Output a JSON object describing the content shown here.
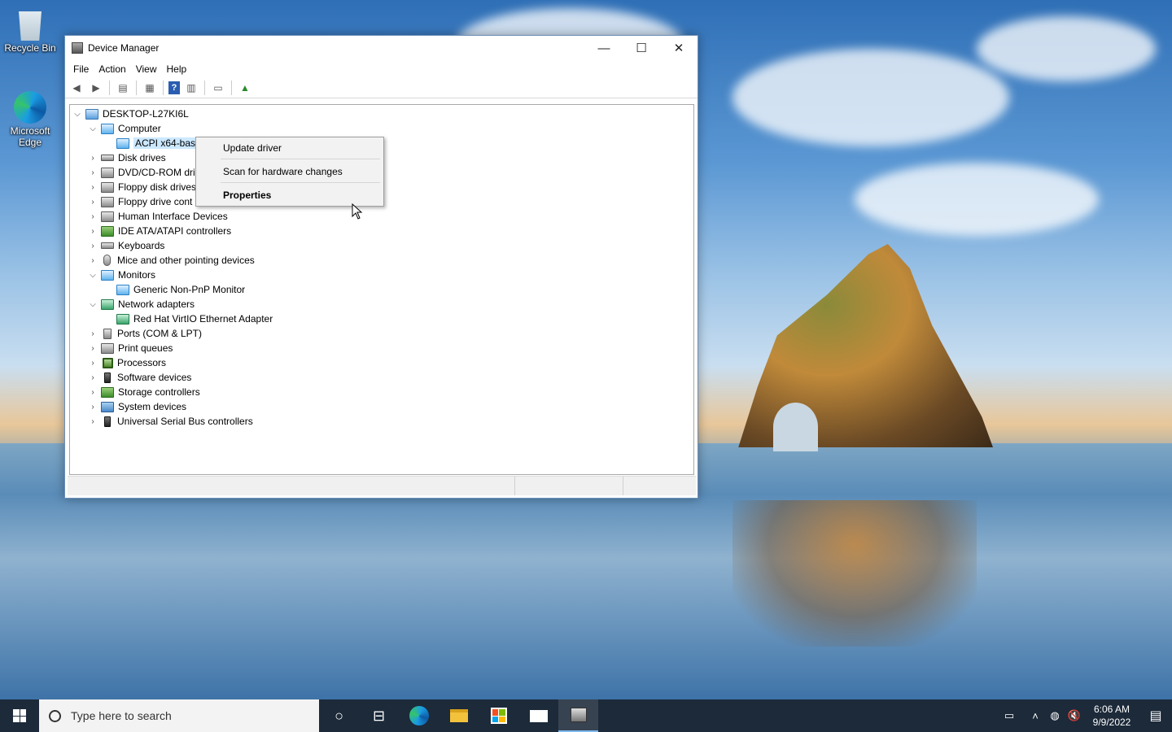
{
  "desktop": {
    "icons": [
      {
        "label": "Recycle Bin"
      },
      {
        "label": "Microsoft Edge"
      }
    ]
  },
  "window": {
    "title": "Device Manager",
    "controls": {
      "minimize": "—",
      "maximize": "☐",
      "close": "✕"
    },
    "menu": [
      "File",
      "Action",
      "View",
      "Help"
    ]
  },
  "tree": {
    "root": "DESKTOP-L27KI6L",
    "items": [
      {
        "label": "Computer",
        "expanded": true
      },
      {
        "label": "ACPI x64-base",
        "child": true
      },
      {
        "label": "Disk drives"
      },
      {
        "label": "DVD/CD-ROM dri"
      },
      {
        "label": "Floppy disk drives"
      },
      {
        "label": "Floppy drive cont"
      },
      {
        "label": "Human Interface Devices"
      },
      {
        "label": "IDE ATA/ATAPI controllers"
      },
      {
        "label": "Keyboards"
      },
      {
        "label": "Mice and other pointing devices"
      },
      {
        "label": "Monitors",
        "expanded": true
      },
      {
        "label": "Generic Non-PnP Monitor",
        "child": true
      },
      {
        "label": "Network adapters",
        "expanded": true
      },
      {
        "label": "Red Hat VirtIO Ethernet Adapter",
        "child": true
      },
      {
        "label": "Ports (COM & LPT)"
      },
      {
        "label": "Print queues"
      },
      {
        "label": "Processors"
      },
      {
        "label": "Software devices"
      },
      {
        "label": "Storage controllers"
      },
      {
        "label": "System devices"
      },
      {
        "label": "Universal Serial Bus controllers"
      }
    ]
  },
  "context_menu": {
    "items": [
      "Update driver",
      "Scan for hardware changes",
      "Properties"
    ]
  },
  "taskbar": {
    "search_placeholder": "Type here to search",
    "time": "6:06 AM",
    "date": "9/9/2022"
  },
  "colors": {
    "taskbar_bg": "#1c2a3a",
    "selection": "#cce8ff"
  }
}
